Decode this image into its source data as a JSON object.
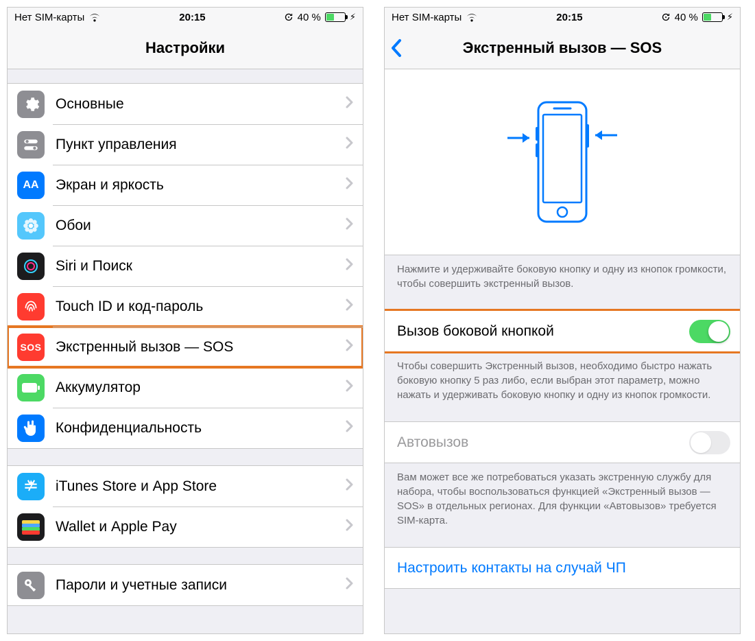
{
  "status": {
    "carrier": "Нет SIM-карты",
    "time": "20:15",
    "battery_pct": "40 %"
  },
  "left": {
    "title": "Настройки",
    "groups": [
      {
        "rows": [
          {
            "id": "general",
            "label": "Основные",
            "icon_bg": "#8e8e93",
            "icon_glyph": "gear"
          },
          {
            "id": "control-center",
            "label": "Пункт управления",
            "icon_bg": "#8e8e93",
            "icon_glyph": "switches"
          },
          {
            "id": "display",
            "label": "Экран и яркость",
            "icon_bg": "#007aff",
            "icon_glyph": "AA"
          },
          {
            "id": "wallpaper",
            "label": "Обои",
            "icon_bg": "#54c7fc",
            "icon_glyph": "flower"
          },
          {
            "id": "siri",
            "label": "Siri и Поиск",
            "icon_bg": "#1c1c1e",
            "icon_glyph": "siri"
          },
          {
            "id": "touchid",
            "label": "Touch ID и код-пароль",
            "icon_bg": "#ff3b30",
            "icon_glyph": "finger"
          },
          {
            "id": "sos",
            "label": "Экстренный вызов — SOS",
            "icon_bg": "#ff3b30",
            "icon_glyph": "SOS",
            "highlight": true
          },
          {
            "id": "battery",
            "label": "Аккумулятор",
            "icon_bg": "#4cd964",
            "icon_glyph": "battery"
          },
          {
            "id": "privacy",
            "label": "Конфиденциальность",
            "icon_bg": "#007aff",
            "icon_glyph": "hand"
          }
        ]
      },
      {
        "rows": [
          {
            "id": "itunes",
            "label": "iTunes Store и App Store",
            "icon_bg": "#1badf8",
            "icon_glyph": "appstore"
          },
          {
            "id": "wallet",
            "label": "Wallet и Apple Pay",
            "icon_bg": "#1c1c1e",
            "icon_glyph": "wallet"
          }
        ]
      },
      {
        "rows": [
          {
            "id": "passwords",
            "label": "Пароли и учетные записи",
            "icon_bg": "#8e8e93",
            "icon_glyph": "key"
          }
        ]
      }
    ]
  },
  "right": {
    "title": "Экстренный вызов — SOS",
    "instruction1": "Нажмите и удерживайте боковую кнопку и одну из кнопок громкости, чтобы совершить экстренный вызов.",
    "toggle1_label": "Вызов боковой кнопкой",
    "toggle1_on": true,
    "instruction2": "Чтобы совершить Экстренный вызов, необходимо быстро нажать боковую кнопку 5 раз либо, если выбран этот параметр, можно нажать и удерживать боковую кнопку и одну из кнопок громкости.",
    "toggle2_label": "Автовызов",
    "toggle2_on": false,
    "instruction3": "Вам может все же потребоваться указать экстренную службу для набора, чтобы воспользоваться функцией «Экстренный вызов — SOS» в отдельных регионах. Для функции «Автовызов» требуется SIM-карта.",
    "link_label": "Настроить контакты на случай ЧП"
  }
}
